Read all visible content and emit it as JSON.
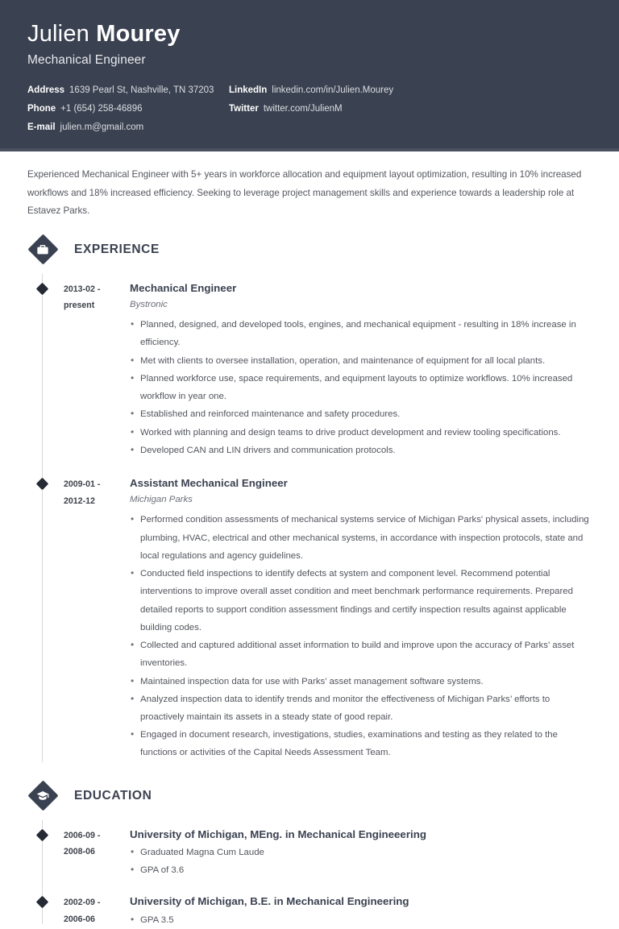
{
  "header": {
    "first_name": "Julien",
    "last_name": "Mourey",
    "job_title": "Mechanical Engineer",
    "contacts": [
      {
        "label": "Address",
        "value": "1639 Pearl St, Nashville, TN 37203"
      },
      {
        "label": "LinkedIn",
        "value": "linkedin.com/in/Julien.Mourey"
      },
      {
        "label": "Phone",
        "value": "+1 (654) 258-46896"
      },
      {
        "label": "Twitter",
        "value": "twitter.com/JulienM"
      },
      {
        "label": "E-mail",
        "value": "julien.m@gmail.com"
      }
    ]
  },
  "summary": "Experienced Mechanical Engineer with 5+ years in workforce allocation and equipment layout optimization, resulting in 10% increased workflows and 18% increased efficiency. Seeking to leverage project management skills and experience towards a leadership role at Estavez Parks.",
  "sections": {
    "experience": {
      "title": "EXPERIENCE",
      "icon": "briefcase-icon",
      "entries": [
        {
          "date_start": "2013-02 -",
          "date_end": "present",
          "title": "Mechanical Engineer",
          "org": "Bystronic",
          "bullets": [
            "Planned, designed, and developed tools, engines, and mechanical equipment - resulting in 18% increase in efficiency.",
            "Met with clients to oversee installation, operation, and maintenance of equipment for all local plants.",
            "Planned workforce use, space requirements, and equipment layouts to optimize workflows. 10% increased workflow in year one.",
            "Established and reinforced maintenance and safety procedures.",
            "Worked with planning and design teams to drive product development and review tooling specifications.",
            "Developed CAN and LIN drivers and communication protocols."
          ]
        },
        {
          "date_start": "2009-01 -",
          "date_end": "2012-12",
          "title": "Assistant Mechanical Engineer",
          "org": "Michigan Parks",
          "bullets": [
            "Performed condition assessments of mechanical systems service of Michigan Parks' physical assets, including plumbing, HVAC, electrical and other mechanical systems, in accordance with inspection protocols, state and local regulations and agency guidelines.",
            "Conducted field inspections to identify defects at system and component level. Recommend potential interventions to improve overall asset condition and meet benchmark performance requirements. Prepared detailed reports to support condition assessment findings and certify inspection results against applicable building codes.",
            "Collected and captured additional asset information to build and improve upon the accuracy of Parks’ asset inventories.",
            "Maintained inspection data for use with Parks’ asset management software systems.",
            "Analyzed inspection data to identify trends and monitor the effectiveness of Michigan Parks’ efforts to proactively maintain its assets in a steady state of good repair.",
            "Engaged in document research, investigations, studies, examinations and testing as they related to the functions or activities of the Capital Needs Assessment Team."
          ]
        }
      ]
    },
    "education": {
      "title": "EDUCATION",
      "icon": "graduation-cap-icon",
      "entries": [
        {
          "date_start": "2006-09 -",
          "date_end": "2008-06",
          "title": "University of Michigan, MEng. in Mechanical Engineeering",
          "bullets": [
            "Graduated Magna Cum Laude",
            "GPA of 3.6"
          ]
        },
        {
          "date_start": "2002-09 -",
          "date_end": "2006-06",
          "title": "University of Michigan, B.E. in Mechanical Engineering",
          "bullets": [
            "GPA 3.5"
          ]
        }
      ]
    }
  },
  "colors": {
    "header_bg": "#3a4150",
    "accent_dark": "#3a4150",
    "body_text": "#53565e",
    "rail": "#d6d8dc"
  }
}
